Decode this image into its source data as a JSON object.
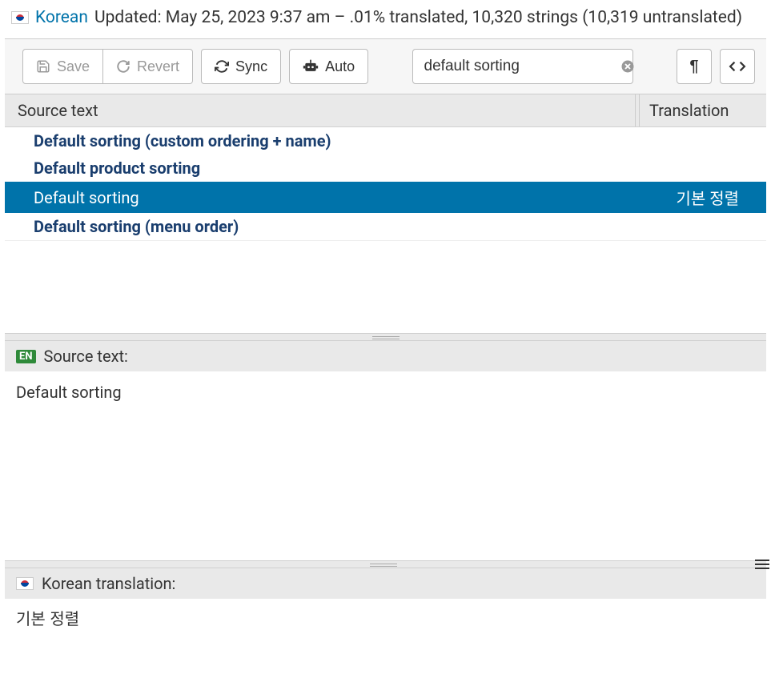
{
  "header": {
    "language": "Korean",
    "meta": "Updated: May 25, 2023 9:37 am – .01% translated, 10,320 strings (10,319 untranslated)"
  },
  "toolbar": {
    "save": "Save",
    "revert": "Revert",
    "sync": "Sync",
    "auto": "Auto",
    "search_value": "default sorting"
  },
  "columns": {
    "source": "Source text",
    "translation": "Translation"
  },
  "rows": [
    {
      "source": "Default sorting (custom ordering + name)",
      "trans": "",
      "selected": false
    },
    {
      "source": "Default product sorting",
      "trans": "",
      "selected": false
    },
    {
      "source": "Default sorting",
      "trans": "기본 정렬",
      "selected": true
    },
    {
      "source": "Default sorting (menu order)",
      "trans": "",
      "selected": false
    }
  ],
  "source_pane": {
    "label": "Source text:",
    "badge": "EN",
    "value": "Default sorting"
  },
  "trans_pane": {
    "label": "Korean translation:",
    "value": "기본 정렬"
  }
}
